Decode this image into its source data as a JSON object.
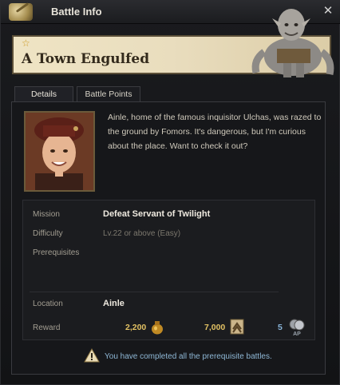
{
  "window": {
    "title": "Battle Info"
  },
  "banner": {
    "title": "A Town Engulfed"
  },
  "tabs": [
    {
      "label": "Details",
      "active": true
    },
    {
      "label": "Battle Points",
      "active": false
    }
  ],
  "dialogue": "Ainle, home of the famous inquisitor Ulchas, was razed to the ground by Fomors. It's dangerous, but I'm curious about the place. Want to check it out?",
  "info": {
    "mission_label": "Mission",
    "mission_value": "Defeat Servant of Twilight",
    "difficulty_label": "Difficulty",
    "difficulty_value": "Lv.22 or above (Easy)",
    "prerequisites_label": "Prerequisites",
    "location_label": "Location",
    "location_value": "Ainle",
    "reward_label": "Reward"
  },
  "rewards": {
    "gold": "2,200",
    "exp": "7,000",
    "ap": "5",
    "ap_icon_text": "AP"
  },
  "notice": "You have completed all the prerequisite battles.",
  "icons": {
    "title": "battle-scroll-icon",
    "close": "close-icon",
    "star": "star-icon",
    "gold": "gold-pouch-icon",
    "exp": "exp-badge-icon",
    "ap": "ap-icon",
    "warning": "warning-icon"
  },
  "colors": {
    "accent_gold": "#e2c163",
    "notice_blue": "#8fb8d6"
  }
}
